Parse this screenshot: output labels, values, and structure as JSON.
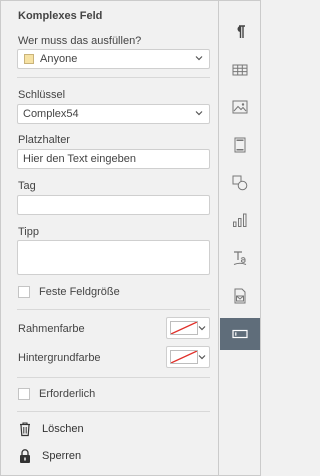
{
  "panel": {
    "title": "Komplexes Feld",
    "fill_by_label": "Wer muss das ausfüllen?",
    "fill_by_value": "Anyone",
    "key_label": "Schlüssel",
    "key_value": "Complex54",
    "placeholder_label": "Platzhalter",
    "placeholder_value": "Hier den Text eingeben",
    "tag_label": "Tag",
    "tag_value": "",
    "tip_label": "Tipp",
    "tip_value": "",
    "fixed_size_label": "Feste Feldgröße",
    "fixed_size_checked": false,
    "border_color_label": "Rahmenfarbe",
    "background_color_label": "Hintergrundfarbe",
    "required_label": "Erforderlich",
    "required_checked": false,
    "delete_label": "Löschen",
    "lock_label": "Sperren"
  },
  "colors": {
    "accent_active_rail": "#5f6d7a",
    "anyone_swatch": "#f6e2a4",
    "no_color_slash": "#e0302a"
  },
  "rail": {
    "items": [
      {
        "icon": "paragraph-icon",
        "active": false
      },
      {
        "icon": "table-icon",
        "active": false
      },
      {
        "icon": "image-icon",
        "active": false
      },
      {
        "icon": "header-footer-icon",
        "active": false
      },
      {
        "icon": "shape-icon",
        "active": false
      },
      {
        "icon": "chart-icon",
        "active": false
      },
      {
        "icon": "text-art-icon",
        "active": false
      },
      {
        "icon": "mail-merge-icon",
        "active": false
      },
      {
        "icon": "form-field-icon",
        "active": true
      }
    ]
  }
}
